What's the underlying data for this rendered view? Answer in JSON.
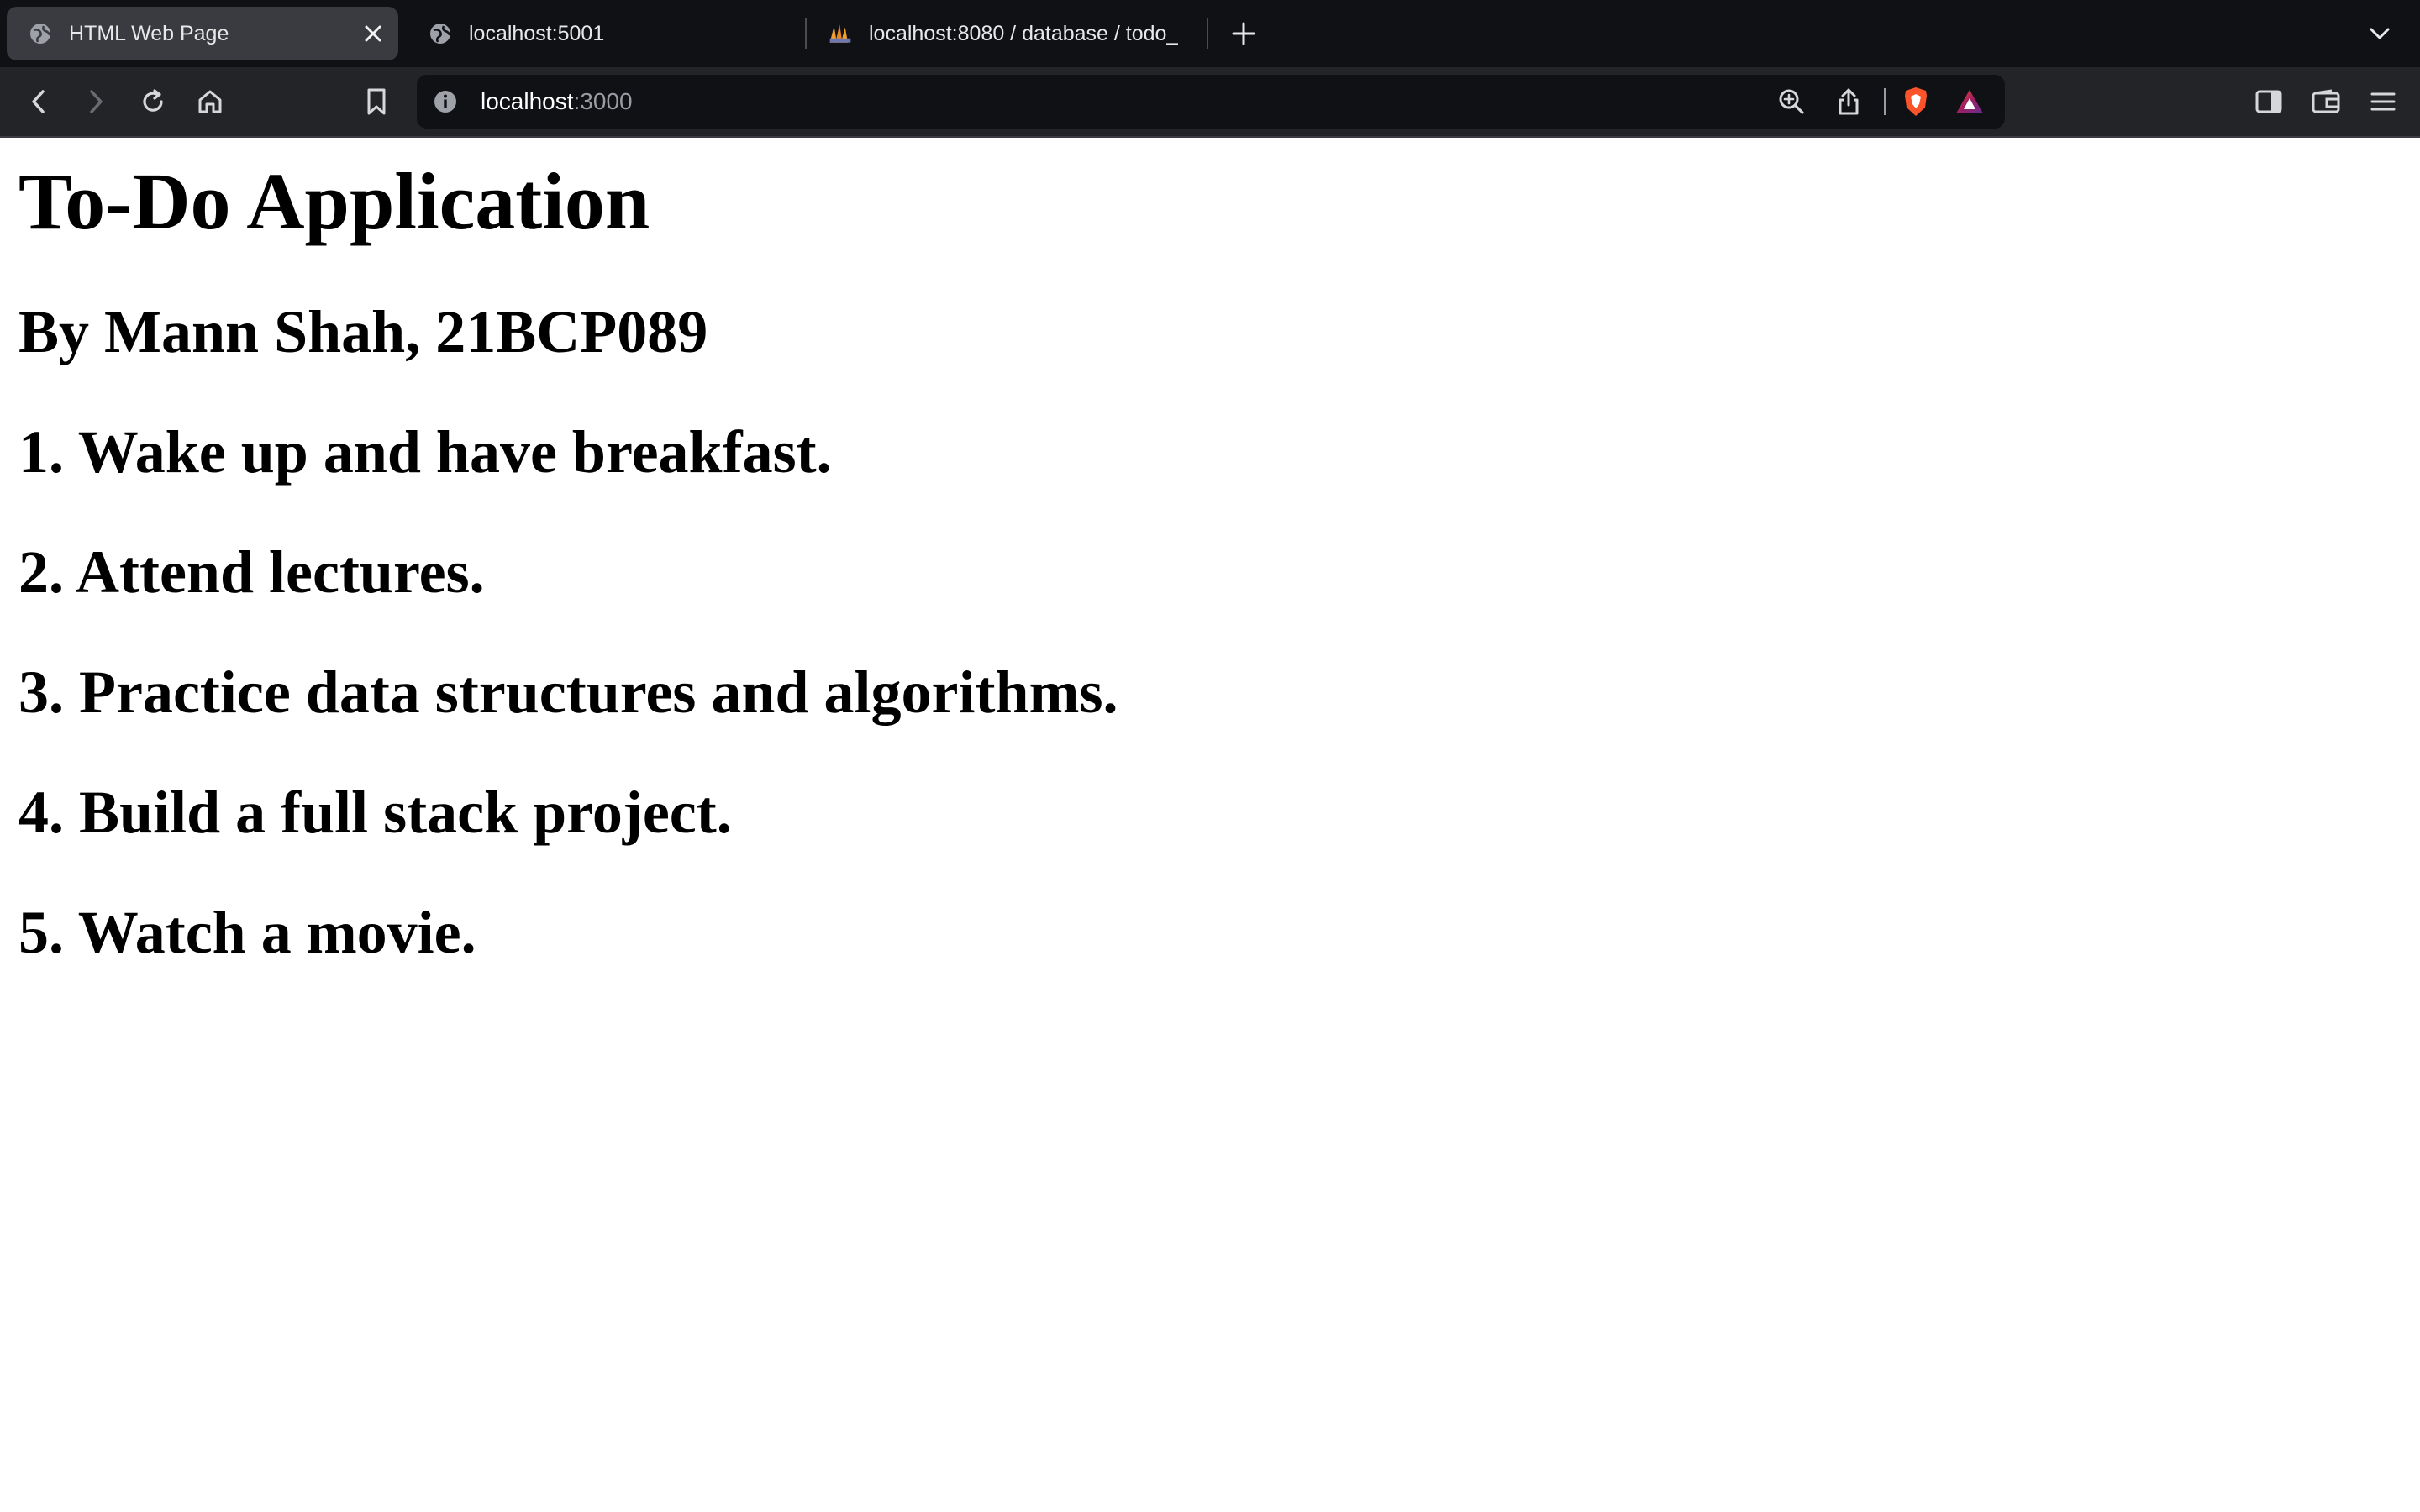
{
  "browser": {
    "tabs": [
      {
        "title": "HTML Web Page",
        "active": true,
        "icon": "globe-icon"
      },
      {
        "title": "localhost:5001",
        "active": false,
        "icon": "globe-icon"
      },
      {
        "title": "localhost:8080 / database / todo_",
        "active": false,
        "icon": "phpmyadmin-icon"
      }
    ],
    "url_host": "localhost",
    "url_port": ":3000"
  },
  "page": {
    "title": "To-Do Application",
    "author": "By Mann Shah, 21BCP089",
    "todos": [
      "1. Wake up and have breakfast.",
      "2. Attend lectures.",
      "3. Practice data structures and algorithms.",
      "4. Build a full stack project.",
      "5. Watch a movie."
    ]
  },
  "colors": {
    "tabbar_bg": "#0f1115",
    "toolbar_bg": "#232428",
    "active_tab_bg": "#3a3b40",
    "brave_orange": "#fb542b",
    "page_bg": "#ffffff",
    "text": "#000000"
  }
}
